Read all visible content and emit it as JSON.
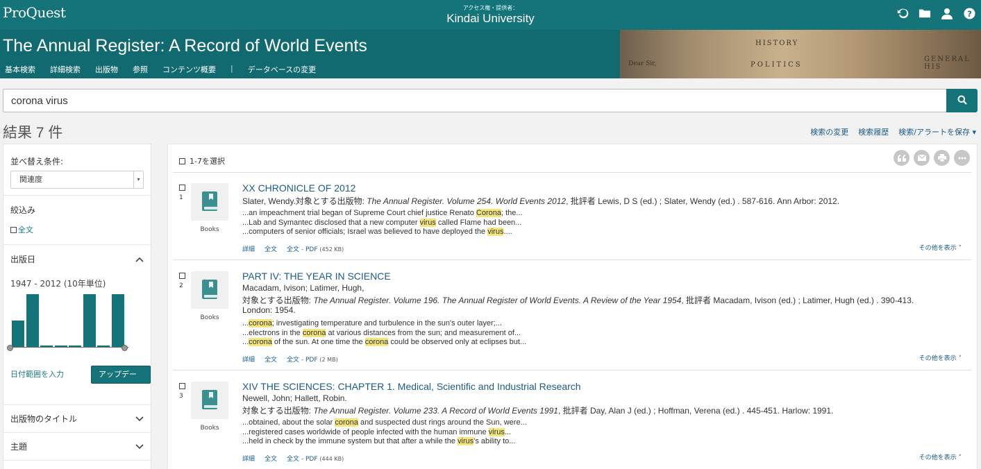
{
  "header": {
    "logo": "ProQuest",
    "access_label": "アクセス権・提供者：",
    "institution": "Kindai University",
    "icons": [
      "history-icon",
      "folder-icon",
      "user-icon",
      "help-icon"
    ]
  },
  "banner": {
    "title": "The Annual Register: A Record of World Events",
    "nav": [
      "基本検索",
      "詳細検索",
      "出版物",
      "参照",
      "コンテンツ概要",
      "|",
      "データベースの変更"
    ],
    "image_text": [
      "HISTORY",
      "POLITICS",
      "GENERAL HIS",
      "Dear Sir,"
    ]
  },
  "search": {
    "query": "corona virus"
  },
  "results_header": {
    "count": "結果 7 件",
    "links": [
      "検索の変更",
      "検索履歴",
      "検索/アラートを保存 ▾"
    ]
  },
  "sidebar": {
    "sort_label": "並べ替え条件:",
    "sort_value": "関連度",
    "filter_label": "絞込み",
    "fulltext": "全文",
    "pubdate_label": "出版日",
    "date_range": "1947 - 2012 (10年単位)",
    "histogram": [
      0.5,
      1.0,
      0.03,
      0.03,
      0.03,
      1.0,
      0.03,
      1.0
    ],
    "date_link": "日付範囲を入力",
    "update_button": "アップデート",
    "facet_pubtitle": "出版物のタイトル",
    "facet_subject": "主題"
  },
  "results": {
    "select_all": "1-7を選択",
    "action_icons": [
      "cite-icon",
      "email-icon",
      "print-icon",
      "more-icon"
    ],
    "items": [
      {
        "num": "1",
        "type": "Books",
        "title": "XX CHRONICLE OF 2012",
        "authors_prefix": "Slater, Wendy.対象とする出版物: ",
        "pub_italic": "The Annual Register. Volume 254. World Events 2012",
        "pub_rest": ", 批評者 Lewis, D S (ed.) ; Slater, Wendy (ed.) .  587-616. Ann Arbor: 2012.",
        "snippets": [
          [
            "...an impeachment trial began of Supreme Court chief justice Renato ",
            "Corona",
            "; the..."
          ],
          [
            "...Lab and Symantec disclosed that a new computer ",
            "virus",
            " called Flame had been..."
          ],
          [
            "...computers of senior officials; Israel was believed to have deployed the ",
            "virus",
            "...."
          ]
        ],
        "links": [
          "詳細",
          "全文",
          "全文 - PDF"
        ],
        "pdf_size": "(452 KB)",
        "more": "その他を表示 ˅"
      },
      {
        "num": "2",
        "type": "Books",
        "title": "PART IV: THE YEAR IN SCIENCE",
        "authors": "Macadam, Ivison; Latimer, Hugh,",
        "pub_prefix": "対象とする出版物: ",
        "pub_italic": "The Annual Register. Volume 196. The Annual Register of World Events. A Review of the Year 1954",
        "pub_rest": ", 批評者 Macadam, Ivison (ed.) ; Latimer, Hugh (ed.) .  390-413.",
        "pub_line2": "London: 1954.",
        "snippets": [
          [
            "...",
            "corona",
            "; investigating temperature and turbulence in the sun's outer layer;..."
          ],
          [
            "...electrons in the ",
            "corona",
            " at various distances from the sun; and measurement of..."
          ],
          [
            "...",
            "corona",
            " of the sun. At one time the ",
            "corona",
            " could be observed only at eclipses but..."
          ]
        ],
        "links": [
          "詳細",
          "全文",
          "全文 - PDF"
        ],
        "pdf_size": "(2 MB)",
        "more": "その他を表示 ˅"
      },
      {
        "num": "3",
        "type": "Books",
        "title": "XIV THE SCIENCES: CHAPTER 1. Medical, Scientific and Industrial Research",
        "authors": "Newell, John; Hallett, Robin.",
        "pub_prefix": "対象とする出版物: ",
        "pub_italic": "The Annual Register. Volume 233. A Record of World Events 1991",
        "pub_rest": ", 批評者 Day, Alan J (ed.) ; Hoffman, Verena (ed.) .  445-451. Harlow: 1991.",
        "snippets": [
          [
            "...obtained, about the solar ",
            "corona",
            " and suspected dust rings around the Sun, were..."
          ],
          [
            "...registered cases worldwide of people infected with the human immune ",
            "virus",
            "..."
          ],
          [
            "...held in check by the immune system but that after a while the ",
            "virus",
            "'s ability to..."
          ]
        ],
        "links": [
          "詳細",
          "全文",
          "全文 - PDF"
        ],
        "pdf_size": "(444 KB)",
        "more": "その他を表示 ˅"
      }
    ]
  }
}
